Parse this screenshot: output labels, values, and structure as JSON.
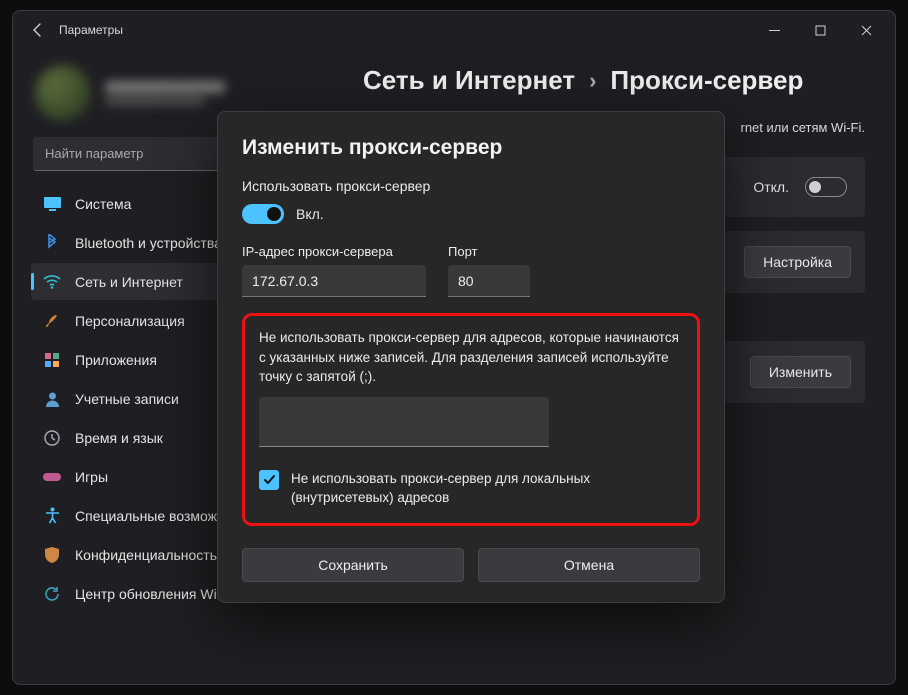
{
  "titlebar": {
    "title": "Параметры"
  },
  "search": {
    "placeholder": "Найти параметр"
  },
  "nav": [
    {
      "label": "Система",
      "icon": "display",
      "color": "#4cc2ff"
    },
    {
      "label": "Bluetooth и устройства",
      "icon": "bt",
      "color": "#3a8de0"
    },
    {
      "label": "Сеть и Интернет",
      "icon": "wifi",
      "color": "#35c0d0",
      "selected": true
    },
    {
      "label": "Персонализация",
      "icon": "brush",
      "color": "#d08030"
    },
    {
      "label": "Приложения",
      "icon": "apps",
      "color": "#d06a88"
    },
    {
      "label": "Учетные записи",
      "icon": "user",
      "color": "#5aa0d0"
    },
    {
      "label": "Время и язык",
      "icon": "clock",
      "color": "#aab"
    },
    {
      "label": "Игры",
      "icon": "game",
      "color": "#c05a90"
    },
    {
      "label": "Специальные возможности",
      "icon": "access",
      "color": "#4cc2ff"
    },
    {
      "label": "Конфиденциальность и защита",
      "icon": "shield",
      "color": "#c84"
    },
    {
      "label": "Центр обновления Windows",
      "icon": "update",
      "color": "#3aa0c0"
    }
  ],
  "breadcrumb": {
    "a": "Сеть и Интернет",
    "b": "Прокси-сервер"
  },
  "hint": "rnet или сетям Wi-Fi.",
  "card_auto": {
    "label": "Откл."
  },
  "card_setup": {
    "label": "Настройка"
  },
  "card_edit": {
    "label": "Изменить"
  },
  "dialog": {
    "title": "Изменить прокси-сервер",
    "use_label": "Использовать прокси-сервер",
    "toggle_state": "Вкл.",
    "ip_label": "IP-адрес прокси-сервера",
    "ip_value": "172.67.0.3",
    "port_label": "Порт",
    "port_value": "80",
    "exclude_text": "Не использовать прокси-сервер для адресов, которые начинаются с указанных ниже записей. Для разделения записей используйте точку с запятой (;).",
    "local_label": "Не использовать прокси-сервер для локальных (внутрисетевых) адресов",
    "save": "Сохранить",
    "cancel": "Отмена"
  }
}
